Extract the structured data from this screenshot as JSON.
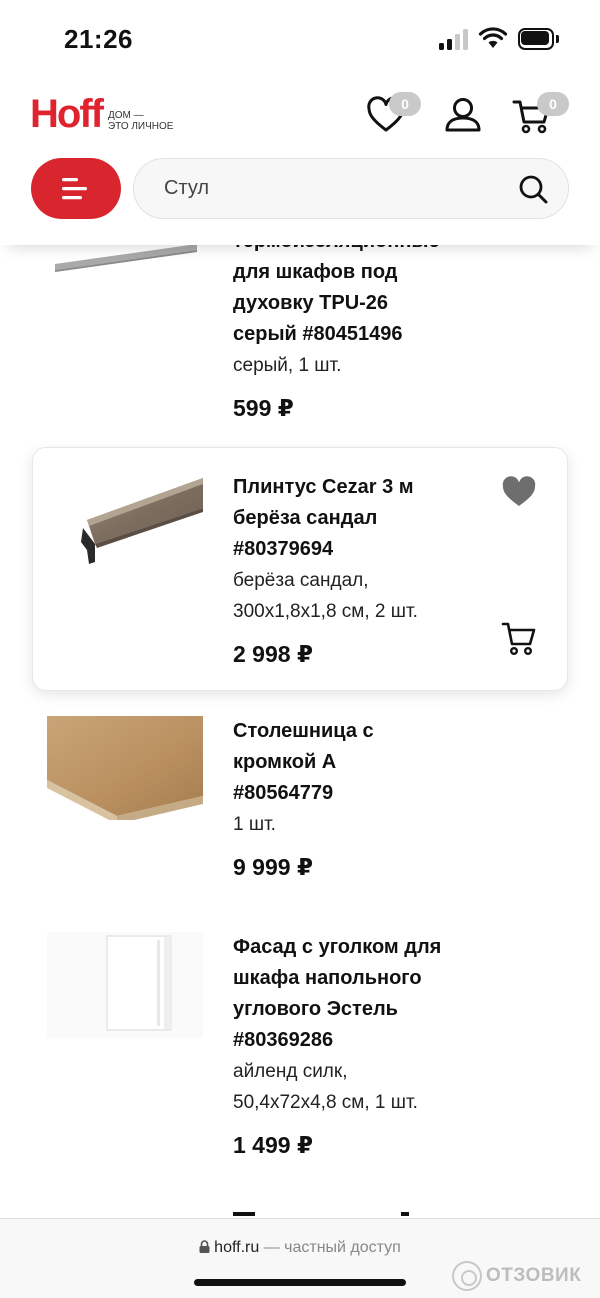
{
  "status_bar": {
    "time": "21:26"
  },
  "header": {
    "logo_text": "Hoff",
    "logo_tagline_1": "ДОМ —",
    "logo_tagline_2": "ЭТО ЛИЧНОЕ",
    "favorites_count": "0",
    "cart_count": "0",
    "brand_color": "#e0242f"
  },
  "search": {
    "placeholder": "Стул",
    "value": ""
  },
  "products": [
    {
      "title_lines": [
        "термоизоляционные",
        "для шкафов под",
        "духовку TPU-26",
        "серый #80451496"
      ],
      "meta_lines": [
        "серый, 1 шт."
      ],
      "price": "599 ₽",
      "partially_visible": true
    },
    {
      "title_lines": [
        "Плинтус Cezar 3 м",
        "берёза сандал",
        "#80379694"
      ],
      "meta_lines": [
        "берёза сандал,",
        "300x1,8x1,8 см, 2 шт."
      ],
      "price": "2 998 ₽",
      "highlighted": true
    },
    {
      "title_lines": [
        "Столешница с",
        "кромкой А",
        "#80564779"
      ],
      "meta_lines": [
        "1 шт."
      ],
      "price": "9 999 ₽"
    },
    {
      "title_lines": [
        "Фасад с уголком для",
        "шкафа напольного",
        "углового Эстель",
        "#80369286"
      ],
      "meta_lines": [
        "айленд силк,",
        "50,4x72x4,8 см, 1 шт."
      ],
      "price": "1 499 ₽"
    }
  ],
  "browser": {
    "url_host": "hoff.ru",
    "url_separator": " — ",
    "url_suffix": "частный доступ",
    "watermark": "ОТЗОВИК"
  },
  "icons": {
    "favorites": "heart-outline-icon",
    "account": "user-icon",
    "cart": "cart-icon",
    "menu": "menu-icon",
    "search": "search-icon",
    "card_favorite": "heart-filled-icon",
    "card_cart": "cart-icon",
    "lock": "lock-icon"
  }
}
